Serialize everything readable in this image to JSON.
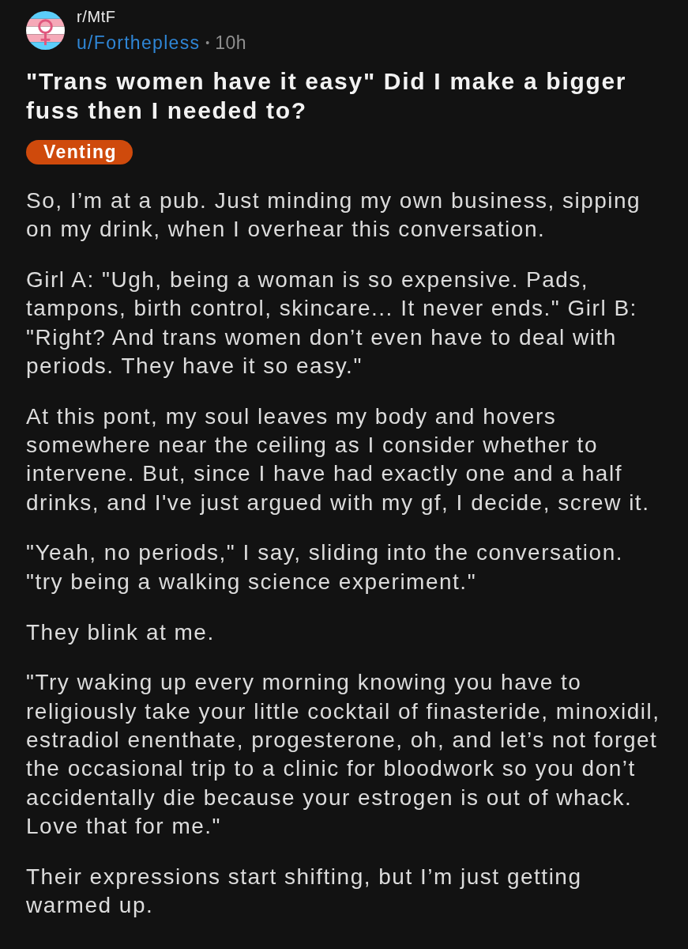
{
  "post": {
    "subreddit": "r/MtF",
    "author": "u/Forthepless",
    "separator": "•",
    "age": "10h",
    "title": "\"Trans women have it easy\" Did I make a bigger fuss then I needed to?",
    "flair": {
      "label": "Venting"
    },
    "body": [
      "So, I’m at a pub. Just minding my own business, sipping on my drink, when I overhear this conversation.",
      "Girl A: \"Ugh, being a woman is so expensive. Pads, tampons, birth control, skincare... It never ends.\" Girl B: \"Right? And trans women don’t even have to deal with periods. They have it so easy.\"",
      "At this pont, my soul leaves my body and hovers somewhere near the ceiling as I consider whether to intervene. But, since I have had exactly one and a half drinks, and I've just argued with my gf, I decide, screw it.",
      "\"Yeah, no periods,\" I say, sliding into the conversation. \"try being a walking science experiment.\"",
      "They blink at me.",
      "\"Try waking up every morning knowing you have to religiously take your little cocktail of finasteride, minoxidil, estradiol enenthate, progesterone, oh, and let’s not forget the occasional trip to a clinic for bloodwork so you don’t accidentally die because your estrogen is out of whack. Love that for me.\"",
      "Their expressions start shifting, but I’m just getting warmed up."
    ]
  }
}
